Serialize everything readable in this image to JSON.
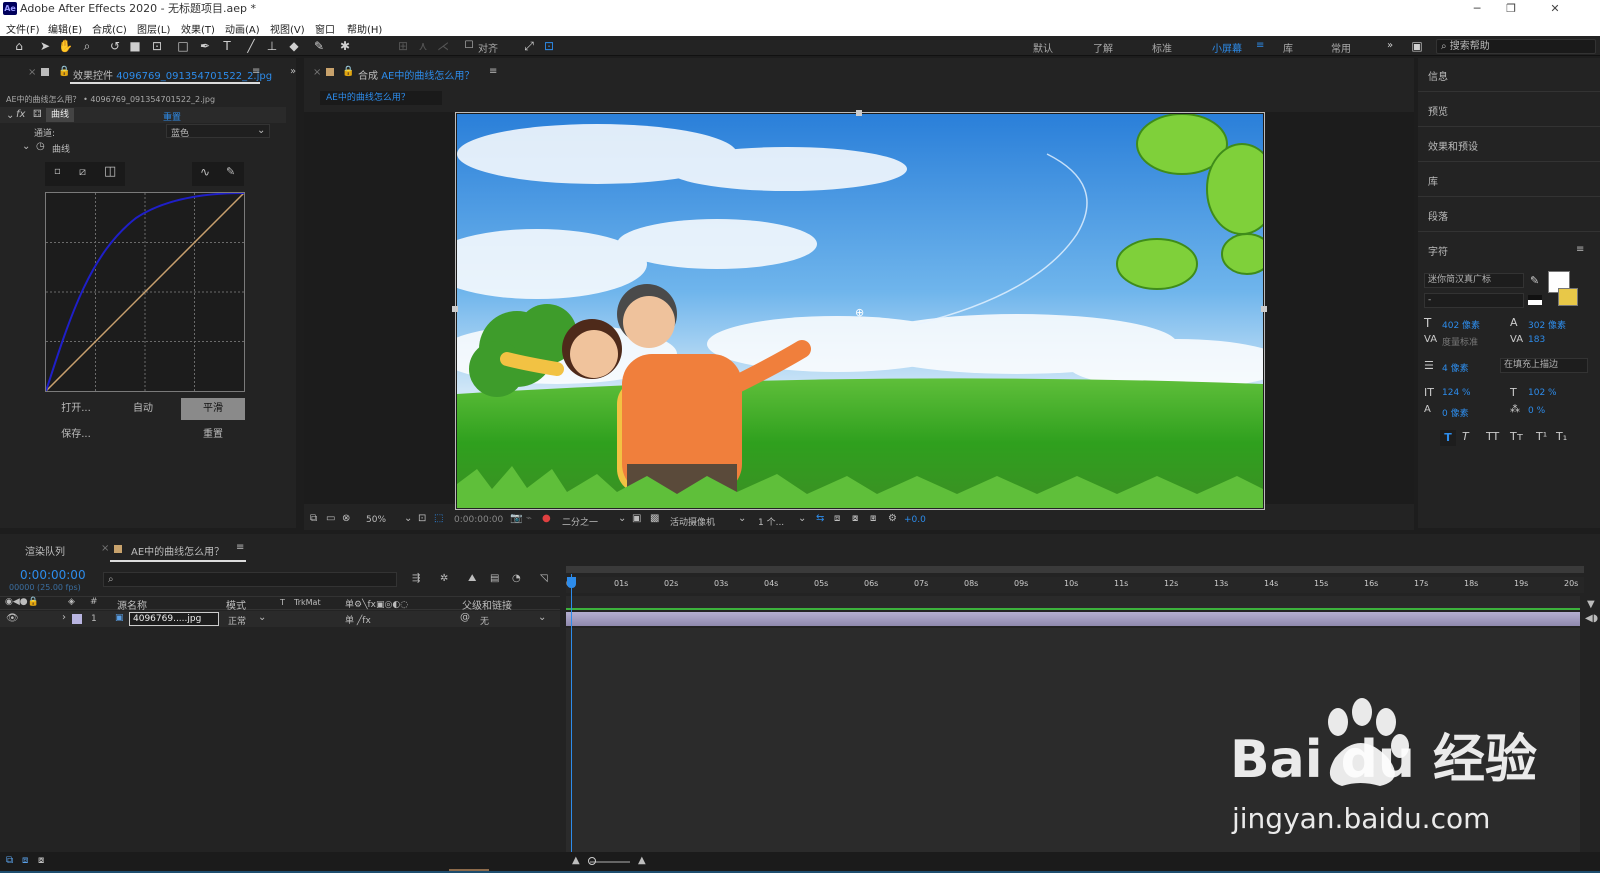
{
  "app": {
    "title": "Adobe After Effects 2020 - 无标题项目.aep *",
    "logo": "Ae"
  },
  "menu": [
    "文件(F)",
    "编辑(E)",
    "合成(C)",
    "图层(L)",
    "效果(T)",
    "动画(A)",
    "视图(V)",
    "窗口",
    "帮助(H)"
  ],
  "toolbar": {
    "snap_label": "对齐",
    "workspaces": [
      "默认",
      "了解",
      "标准",
      "小屏幕",
      "库",
      "常用"
    ],
    "active_workspace": "小屏幕",
    "search_placeholder": "搜索帮助"
  },
  "effects_panel": {
    "tab_prefix": "效果控件",
    "tab_file": "4096769_091354701522_2.jpg",
    "breadcrumb": "AE中的曲线怎么用？ • 4096769_091354701522_2.jpg",
    "fx_name": "曲线",
    "reset_label": "重置",
    "channel_label": "通道:",
    "channel_value": "蓝色",
    "curves_label": "曲线",
    "buttons": {
      "open": "打开...",
      "auto": "自动",
      "smooth": "平滑",
      "save": "保存...",
      "reset": "重置"
    }
  },
  "comp_panel": {
    "tab_prefix": "合成",
    "comp_name": "AE中的曲线怎么用？",
    "zoom": "50%",
    "timecode": "0:00:00:00",
    "resolution": "二分之一",
    "camera": "活动摄像机",
    "views": "1 个...",
    "exposure": "+0.0"
  },
  "right_panel": {
    "items": [
      "信息",
      "预览",
      "效果和预设",
      "库",
      "段落",
      "字符"
    ],
    "font_family": "迷你简汉真广标",
    "font_style": "-",
    "font_size": "402 像素",
    "leading": "302 像素",
    "kerning": "度量标准",
    "tracking": "183",
    "stroke_width": "4 像素",
    "stroke_type": "在填充上描边",
    "vscale": "124 %",
    "hscale": "102 %",
    "baseline": "0 像素",
    "tsume": "0 %",
    "style_buttons": [
      "T",
      "T",
      "TT",
      "Tт",
      "T¹",
      "T₁"
    ]
  },
  "timeline": {
    "tab_render": "渲染队列",
    "tab_comp": "AE中的曲线怎么用？",
    "timecode": "0:00:00:00",
    "fps": "00000 (25.00 fps)",
    "columns": {
      "source": "源名称",
      "mode": "模式",
      "t": "T",
      "trkmat": "TrkMat",
      "parent": "父级和链接"
    },
    "layer": {
      "index": "1",
      "name": "4096769.....jpg",
      "mode": "正常",
      "parent": "无"
    },
    "ticks": [
      "0s",
      "01s",
      "02s",
      "03s",
      "04s",
      "05s",
      "06s",
      "07s",
      "08s",
      "09s",
      "10s",
      "11s",
      "12s",
      "13s",
      "14s",
      "15s",
      "16s",
      "17s",
      "18s",
      "19s",
      "20s"
    ]
  },
  "watermark": {
    "brand": "Bai du 经验",
    "url": "jingyan.baidu.com"
  }
}
